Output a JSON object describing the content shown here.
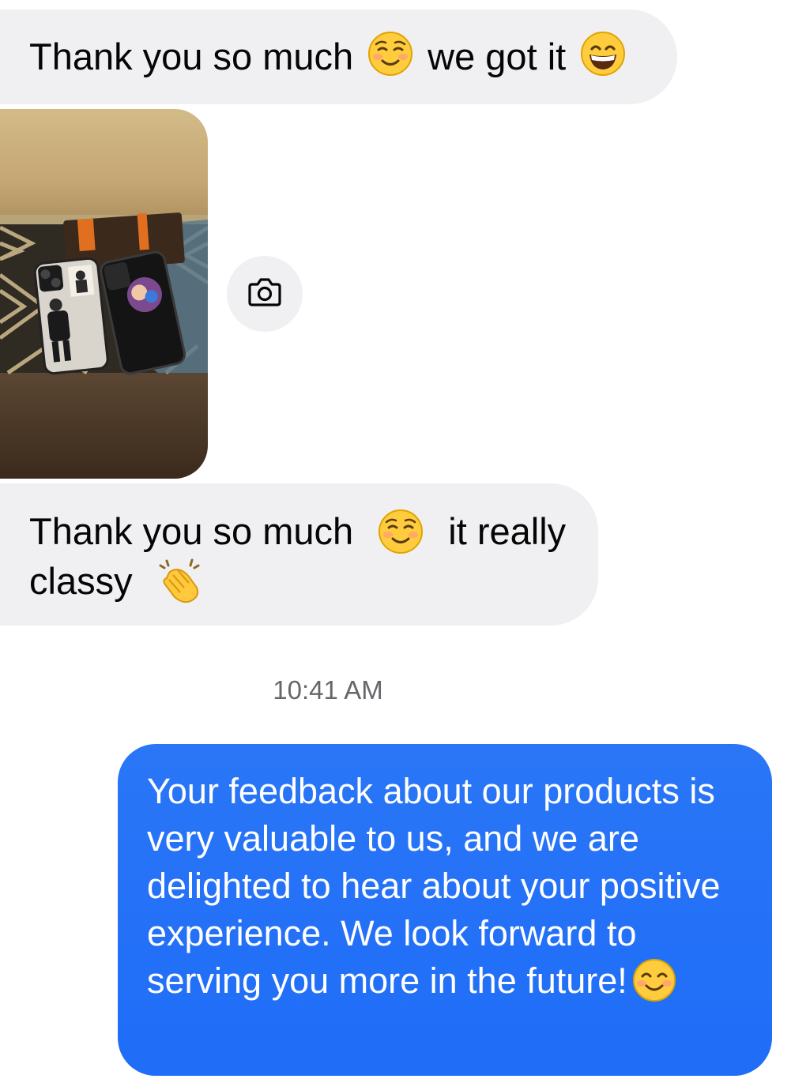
{
  "messages": {
    "incoming_1": {
      "text_a": "Thank you so much",
      "emoji_a": "smiling-face-icon",
      "text_b": "we got it",
      "emoji_b": "grinning-face-icon"
    },
    "photo": {
      "icon": "camera-icon"
    },
    "incoming_2": {
      "text_a": "Thank you so much",
      "emoji_a": "smiling-face-icon",
      "text_b": "it really",
      "text_c": "classy",
      "emoji_c": "clapping-hands-icon"
    },
    "timestamp": "10:41 AM",
    "outgoing_1": {
      "text": "Your feedback about our products is very valuable to us, and we are delighted to hear about your positive experience. We look forward to serving you more in the future!",
      "emoji": "smiling-face-with-smiling-eyes-icon"
    }
  },
  "colors": {
    "incoming_bubble": "#f0f0f2",
    "outgoing_bubble": "#1f6df8",
    "timestamp": "#65676b"
  }
}
